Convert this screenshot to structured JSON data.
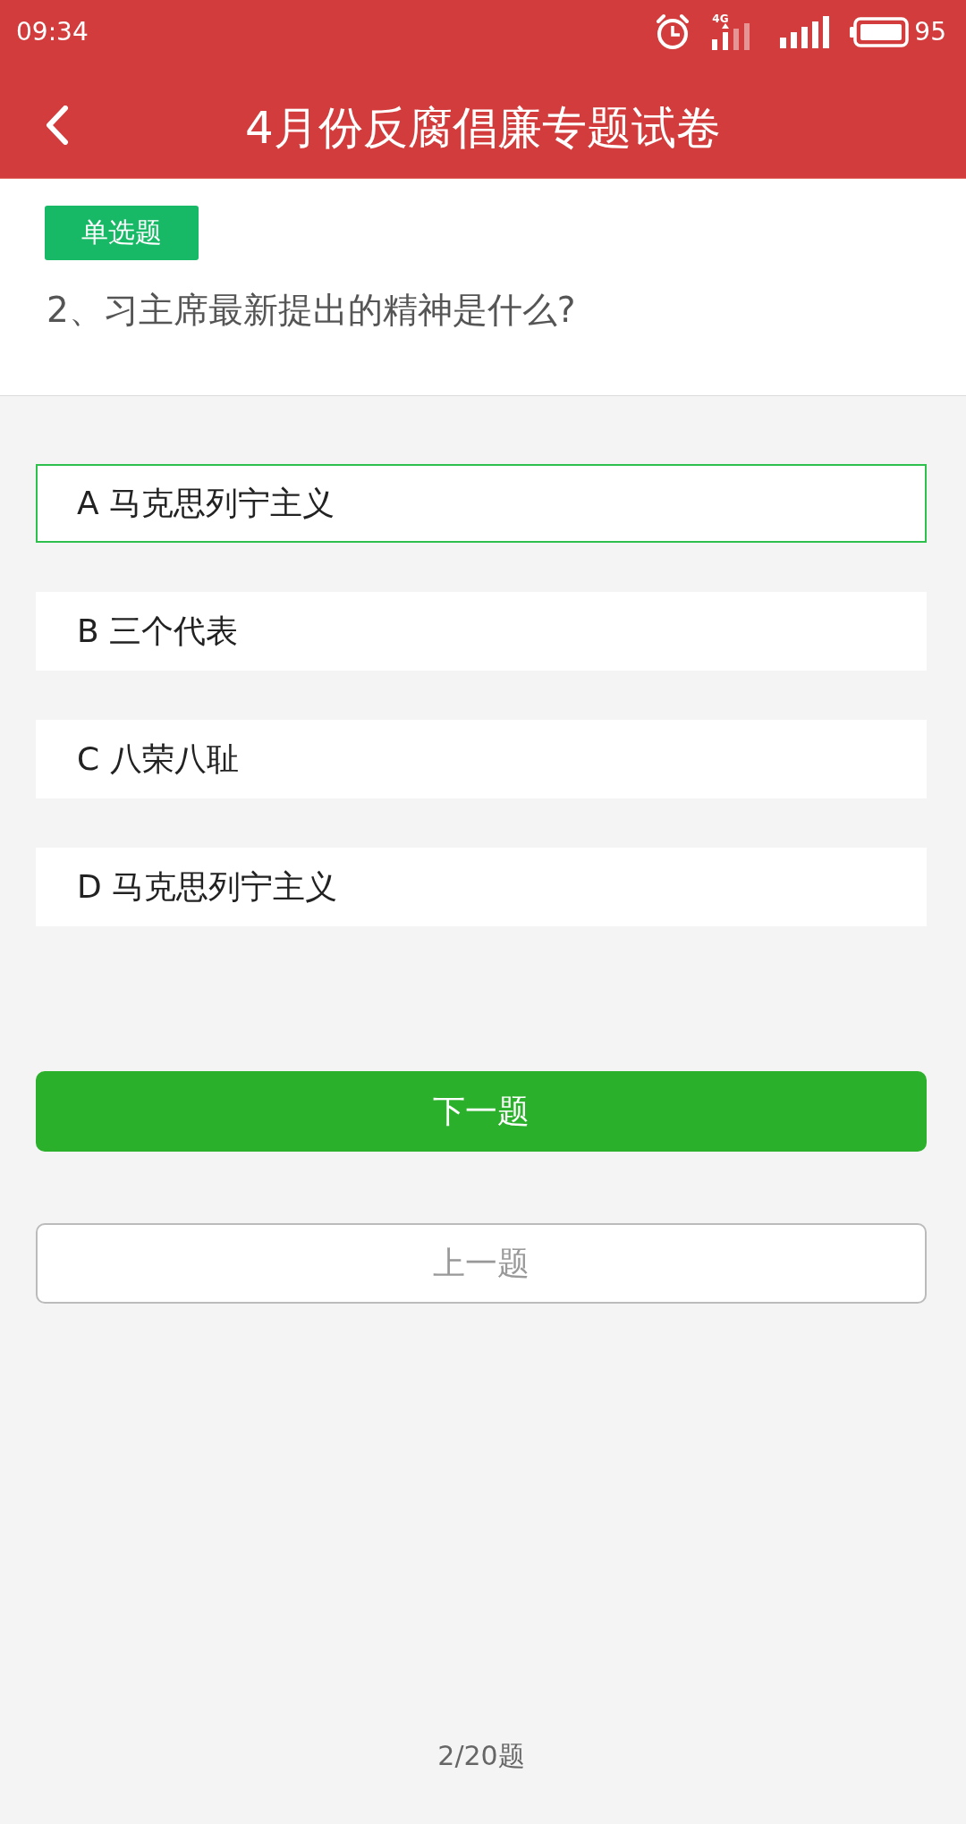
{
  "status_bar": {
    "time": "09:34",
    "network": "4G",
    "battery": "95"
  },
  "header": {
    "title": "4月份反腐倡廉专题试卷"
  },
  "question": {
    "type_tag": "单选题",
    "text": "2、习主席最新提出的精神是什么?"
  },
  "options": [
    {
      "label": "A 马克思列宁主义",
      "selected": true
    },
    {
      "label": "B 三个代表",
      "selected": false
    },
    {
      "label": "C 八荣八耻",
      "selected": false
    },
    {
      "label": "D 马克思列宁主义",
      "selected": false
    }
  ],
  "buttons": [
    {
      "label": "下一题",
      "kind": "primary"
    },
    {
      "label": "上一题",
      "kind": "secondary"
    }
  ],
  "footer": {
    "counter": "2/20题"
  }
}
